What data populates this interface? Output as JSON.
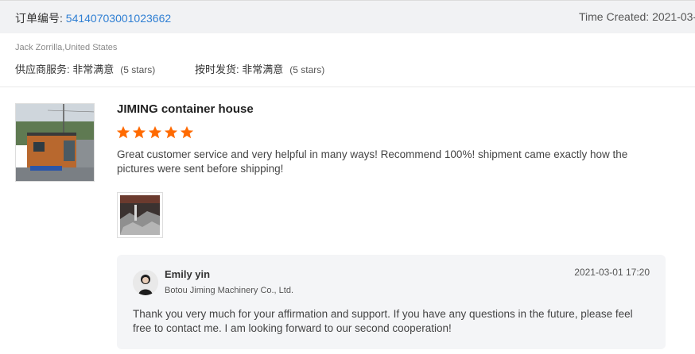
{
  "order": {
    "label": "订单编号: ",
    "number": "54140703001023662",
    "time_created": "Time Created: 2021-03-0"
  },
  "buyer": {
    "name": "Jack Zorrilla,United States"
  },
  "ratings": [
    {
      "label": "供应商服务: 非常满意",
      "note": "(5 stars)"
    },
    {
      "label": "按时发货: 非常满意",
      "note": "(5 stars)"
    }
  ],
  "review": {
    "product_title": "JIMING container house",
    "star_rating": 5,
    "star_color": "#ff6a00",
    "text": "Great customer service and very helpful in many ways! Recommend 100%! shipment came exactly how the pictures were sent before shipping!"
  },
  "reply": {
    "name": "Emily yin",
    "company": "Botou Jiming Machinery Co., Ltd.",
    "time": "2021-03-01 17:20",
    "text": "Thank you very much for your affirmation and support. If you have any questions in the future, please feel free to contact me. I am looking forward to our second cooperation!"
  },
  "colors": {
    "link": "#2f7fd3",
    "header_bg": "#f1f2f4",
    "reply_bg": "#f4f5f7"
  }
}
